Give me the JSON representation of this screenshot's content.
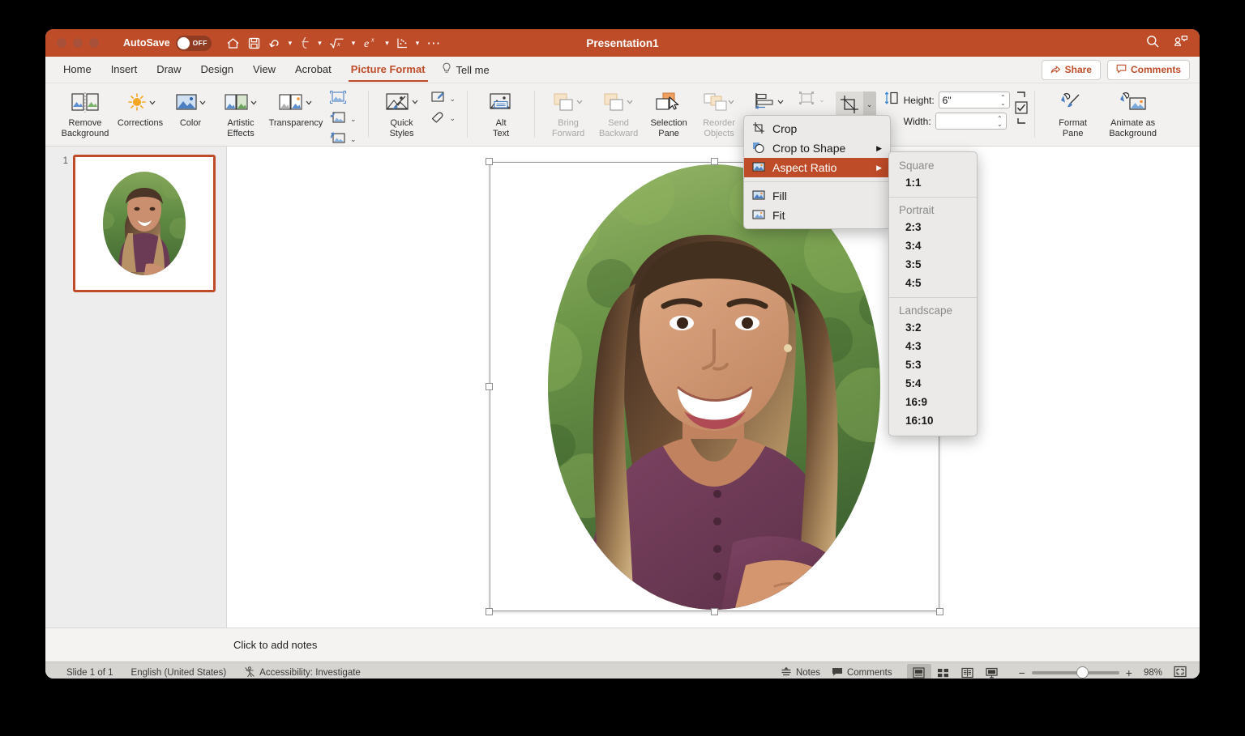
{
  "window": {
    "title": "Presentation1",
    "autosave_label": "AutoSave",
    "autosave_state": "OFF",
    "accent_color": "#bf4c28"
  },
  "quick_access": {
    "items": [
      {
        "name": "home-icon",
        "glyph": "⌂"
      },
      {
        "name": "save-icon",
        "glyph": "Ὃe"
      },
      {
        "name": "undo-icon",
        "glyph": "↶"
      },
      {
        "name": "redo-icon",
        "glyph": "↷"
      },
      {
        "name": "equation-icon",
        "glyph": "√"
      },
      {
        "name": "exponent-icon",
        "glyph": "e"
      },
      {
        "name": "chart-icon",
        "glyph": "⋰"
      },
      {
        "name": "more-icon",
        "glyph": "⋯"
      }
    ]
  },
  "title_bar_right": {
    "search_icon": "search-icon",
    "collab_icon": "collaborators-icon"
  },
  "tabs": [
    {
      "label": "Home",
      "active": false
    },
    {
      "label": "Insert",
      "active": false
    },
    {
      "label": "Draw",
      "active": false
    },
    {
      "label": "Design",
      "active": false
    },
    {
      "label": "View",
      "active": false
    },
    {
      "label": "Acrobat",
      "active": false
    },
    {
      "label": "Picture Format",
      "active": true
    }
  ],
  "tell_me": {
    "label": "Tell me"
  },
  "tab_right_buttons": [
    {
      "label": "Share",
      "icon": "share-icon"
    },
    {
      "label": "Comments",
      "icon": "comment-icon"
    }
  ],
  "ribbon": {
    "groups": [
      {
        "name": "adjust-left",
        "items": [
          {
            "label": "Remove\nBackground",
            "line1": "Remove",
            "line2": "Background",
            "icon": "remove-background-icon",
            "caret": false,
            "disabled": false
          },
          {
            "label": "Corrections",
            "line1": "Corrections",
            "line2": "",
            "icon": "corrections-icon",
            "caret": true,
            "disabled": false
          },
          {
            "label": "Color",
            "line1": "Color",
            "line2": "",
            "icon": "color-icon",
            "caret": true,
            "disabled": false
          },
          {
            "label": "Artistic Effects",
            "line1": "Artistic",
            "line2": "Effects",
            "icon": "artistic-effects-icon",
            "caret": true,
            "disabled": false
          },
          {
            "label": "Transparency",
            "line1": "Transparency",
            "line2": "",
            "icon": "transparency-icon",
            "caret": true,
            "disabled": false
          }
        ]
      },
      {
        "name": "compress-stack",
        "items": [
          {
            "icon": "compress-pictures-icon",
            "caret": false
          },
          {
            "icon": "change-picture-icon",
            "caret": true
          },
          {
            "icon": "reset-picture-icon",
            "caret": true
          }
        ]
      },
      {
        "name": "picture-styles",
        "items": [
          {
            "label": "Quick Styles",
            "line1": "Quick",
            "line2": "Styles",
            "icon": "quick-styles-icon",
            "caret": true,
            "disabled": false
          },
          {
            "icon": "picture-border-icon",
            "caret": true
          },
          {
            "icon": "picture-effects-icon",
            "caret": true
          }
        ]
      },
      {
        "name": "accessibility",
        "items": [
          {
            "label": "Alt Text",
            "line1": "Alt",
            "line2": "Text",
            "icon": "alt-text-icon",
            "caret": false,
            "disabled": false
          }
        ]
      },
      {
        "name": "arrange",
        "items": [
          {
            "label": "Bring Forward",
            "line1": "Bring",
            "line2": "Forward",
            "icon": "bring-forward-icon",
            "caret": true,
            "disabled": true
          },
          {
            "label": "Send Backward",
            "line1": "Send",
            "line2": "Backward",
            "icon": "send-backward-icon",
            "caret": true,
            "disabled": true
          },
          {
            "label": "Selection Pane",
            "line1": "Selection",
            "line2": "Pane",
            "icon": "selection-pane-icon",
            "caret": false,
            "disabled": false
          },
          {
            "label": "Reorder Objects",
            "line1": "Reorder",
            "line2": "Objects",
            "icon": "reorder-objects-icon",
            "caret": true,
            "disabled": true
          },
          {
            "label": "Align",
            "line1": "Align",
            "line2": "",
            "icon": "align-icon",
            "caret": true,
            "disabled": false
          },
          {
            "icon": "group-objects-icon",
            "caret": true
          },
          {
            "icon": "rotate-icon",
            "caret": true
          }
        ]
      },
      {
        "name": "format-pane-group",
        "items": [
          {
            "label": "Format Pane",
            "line1": "Format",
            "line2": "Pane",
            "icon": "format-pane-icon",
            "caret": false,
            "disabled": false
          },
          {
            "label": "Animate as Background",
            "line1": "Animate as",
            "line2": "Background",
            "icon": "animate-as-background-icon",
            "caret": false,
            "disabled": false
          }
        ]
      }
    ],
    "size_group": {
      "crop_button": {
        "name": "crop-button",
        "icon": "crop-icon"
      },
      "height": {
        "label": "Height:",
        "value": "6\"",
        "name": "height-field"
      },
      "width": {
        "label": "Width:",
        "value": "",
        "name": "width-field"
      }
    }
  },
  "crop_menu": {
    "items": [
      {
        "label": "Crop",
        "icon": "crop-icon",
        "submenu": false,
        "selected": false
      },
      {
        "label": "Crop to Shape",
        "icon": "crop-to-shape-icon",
        "submenu": true,
        "selected": false
      },
      {
        "label": "Aspect Ratio",
        "icon": "aspect-ratio-icon",
        "submenu": true,
        "selected": true
      },
      {
        "label": "Fill",
        "icon": "fill-icon",
        "submenu": false,
        "selected": false
      },
      {
        "label": "Fit",
        "icon": "fit-icon",
        "submenu": false,
        "selected": false
      }
    ],
    "divider_after_index": 2
  },
  "aspect_ratio_submenu": {
    "sections": [
      {
        "header": "Square",
        "values": [
          "1:1"
        ]
      },
      {
        "header": "Portrait",
        "values": [
          "2:3",
          "3:4",
          "3:5",
          "4:5"
        ]
      },
      {
        "header": "Landscape",
        "values": [
          "3:2",
          "4:3",
          "5:3",
          "5:4",
          "16:9",
          "16:10"
        ]
      }
    ]
  },
  "thumbnails": {
    "slides": [
      {
        "number": "1"
      }
    ]
  },
  "notes": {
    "placeholder": "Click to add notes"
  },
  "status_bar": {
    "slide_count": "Slide 1 of 1",
    "language": "English (United States)",
    "accessibility": "Accessibility: Investigate",
    "notes_button": "Notes",
    "comments_button": "Comments",
    "zoom_level": "98%",
    "zoom_minus": "−",
    "zoom_plus": "+",
    "view_buttons": [
      {
        "name": "normal-view-button",
        "active": true
      },
      {
        "name": "slide-sorter-button",
        "active": false
      },
      {
        "name": "reading-view-button",
        "active": false
      },
      {
        "name": "slideshow-button",
        "active": false
      }
    ],
    "fit-slide": "fit-slide-icon"
  }
}
